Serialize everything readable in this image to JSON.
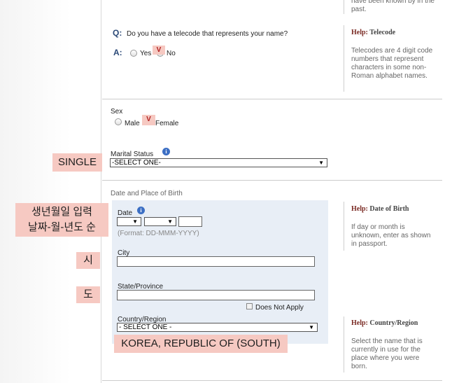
{
  "help_top": {
    "text": "have been known by in the past."
  },
  "telecode": {
    "q_label": "Q:",
    "question": "Do you have a telecode that represents your name?",
    "a_label": "A:",
    "opt_yes": "Yes",
    "opt_no": "No",
    "mark": "V",
    "help_prefix": "Help:",
    "help_title": "Telecode",
    "help_text": "Telecodes are 4 digit code numbers that represent characters in some non-Roman alphabet names."
  },
  "sex": {
    "label": "Sex",
    "opt_male": "Male",
    "opt_female": "Female",
    "mark": "V"
  },
  "marital": {
    "label": "Marital Status",
    "info": "i",
    "selected": "-SELECT ONE-",
    "note": "SINGLE"
  },
  "birth": {
    "section_title": "Date and Place of Birth",
    "date_label": "Date",
    "date_info": "i",
    "date_format": "(Format: DD-MMM-YYYY)",
    "date_note_line1": "생년월일 입력",
    "date_note_line2": "날짜-월-년도 순",
    "city_label": "City",
    "city_note": "시",
    "state_label": "State/Province",
    "state_note": "도",
    "does_not_apply": "Does Not Apply",
    "country_label": "Country/Region",
    "country_selected": "- SELECT ONE -",
    "country_note": "KOREA, REPUBLIC OF (SOUTH)",
    "help_date_prefix": "Help:",
    "help_date_title": "Date of Birth",
    "help_date_text": "If day or month is unknown, enter as shown in passport.",
    "help_country_prefix": "Help:",
    "help_country_title": "Country/Region",
    "help_country_text": "Select the name that is currently in use for the place where you were born."
  },
  "icons": {
    "dropdown": "▼"
  },
  "colors": {
    "annotation": "#f6c9c2",
    "qa_label": "#2c4a78",
    "help_title": "#7a2a23",
    "birth_panel": "#e8eef6"
  }
}
